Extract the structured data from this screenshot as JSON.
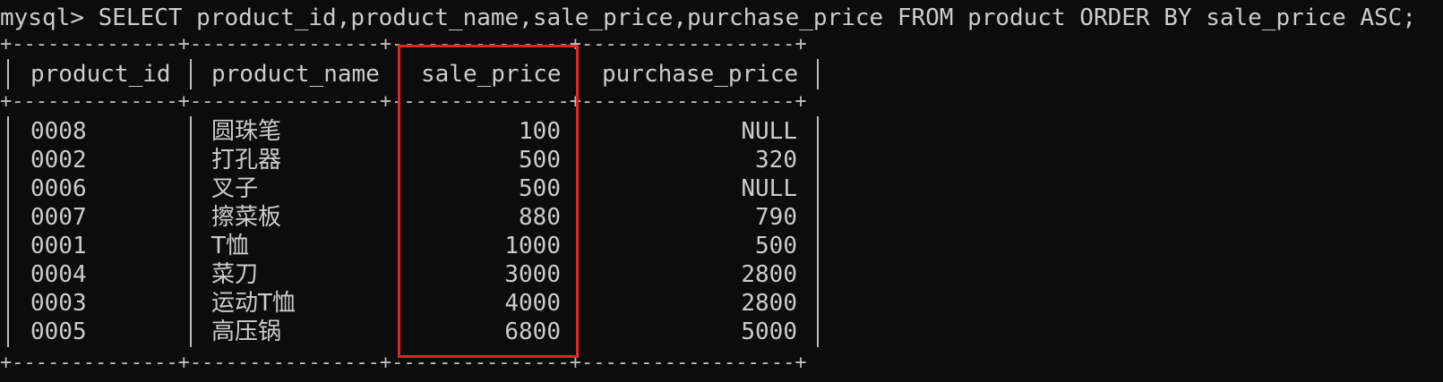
{
  "terminal": {
    "prompt": "mysql> ",
    "command": "SELECT product_id,product_name,sale_price,purchase_price FROM product ORDER BY sale_price ASC;"
  },
  "table": {
    "border_top": "+--------------+----------------+---------------+------------------+",
    "border_mid": "+--------------+----------------+---------------+------------------+",
    "border_bottom": "+--------------+----------------+---------------+------------------+",
    "columns": [
      "product_id",
      "product_name",
      "sale_price",
      "purchase_price"
    ],
    "rows": [
      {
        "product_id": "0008",
        "product_name": "圆珠笔",
        "sale_price": "100",
        "purchase_price": "NULL"
      },
      {
        "product_id": "0002",
        "product_name": "打孔器",
        "sale_price": "500",
        "purchase_price": "320"
      },
      {
        "product_id": "0006",
        "product_name": "叉子",
        "sale_price": "500",
        "purchase_price": "NULL"
      },
      {
        "product_id": "0007",
        "product_name": "擦菜板",
        "sale_price": "880",
        "purchase_price": "790"
      },
      {
        "product_id": "0001",
        "product_name": "T恤",
        "sale_price": "1000",
        "purchase_price": "500"
      },
      {
        "product_id": "0004",
        "product_name": "菜刀",
        "sale_price": "3000",
        "purchase_price": "2800"
      },
      {
        "product_id": "0003",
        "product_name": "运动T恤",
        "sale_price": "4000",
        "purchase_price": "2800"
      },
      {
        "product_id": "0005",
        "product_name": "高压锅",
        "sale_price": "6800",
        "purchase_price": "5000"
      }
    ]
  },
  "colors": {
    "background": "#0c0c0c",
    "text": "#cccccc",
    "highlight": "#e0242c"
  }
}
